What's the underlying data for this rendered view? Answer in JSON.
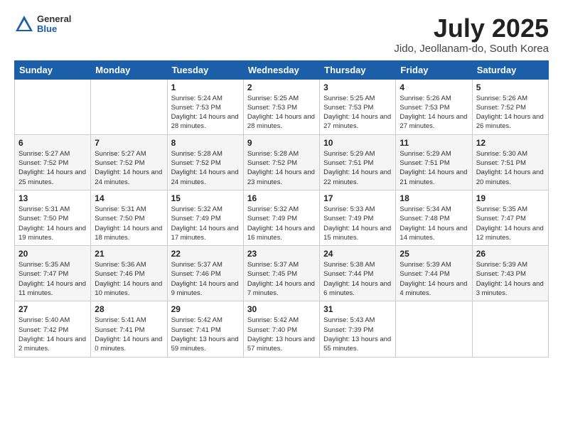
{
  "header": {
    "logo_general": "General",
    "logo_blue": "Blue",
    "month_title": "July 2025",
    "location": "Jido, Jeollanam-do, South Korea"
  },
  "days_of_week": [
    "Sunday",
    "Monday",
    "Tuesday",
    "Wednesday",
    "Thursday",
    "Friday",
    "Saturday"
  ],
  "weeks": [
    [
      {
        "day": "",
        "info": ""
      },
      {
        "day": "",
        "info": ""
      },
      {
        "day": "1",
        "info": "Sunrise: 5:24 AM\nSunset: 7:53 PM\nDaylight: 14 hours\nand 28 minutes."
      },
      {
        "day": "2",
        "info": "Sunrise: 5:25 AM\nSunset: 7:53 PM\nDaylight: 14 hours\nand 28 minutes."
      },
      {
        "day": "3",
        "info": "Sunrise: 5:25 AM\nSunset: 7:53 PM\nDaylight: 14 hours\nand 27 minutes."
      },
      {
        "day": "4",
        "info": "Sunrise: 5:26 AM\nSunset: 7:53 PM\nDaylight: 14 hours\nand 27 minutes."
      },
      {
        "day": "5",
        "info": "Sunrise: 5:26 AM\nSunset: 7:52 PM\nDaylight: 14 hours\nand 26 minutes."
      }
    ],
    [
      {
        "day": "6",
        "info": "Sunrise: 5:27 AM\nSunset: 7:52 PM\nDaylight: 14 hours\nand 25 minutes."
      },
      {
        "day": "7",
        "info": "Sunrise: 5:27 AM\nSunset: 7:52 PM\nDaylight: 14 hours\nand 24 minutes."
      },
      {
        "day": "8",
        "info": "Sunrise: 5:28 AM\nSunset: 7:52 PM\nDaylight: 14 hours\nand 24 minutes."
      },
      {
        "day": "9",
        "info": "Sunrise: 5:28 AM\nSunset: 7:52 PM\nDaylight: 14 hours\nand 23 minutes."
      },
      {
        "day": "10",
        "info": "Sunrise: 5:29 AM\nSunset: 7:51 PM\nDaylight: 14 hours\nand 22 minutes."
      },
      {
        "day": "11",
        "info": "Sunrise: 5:29 AM\nSunset: 7:51 PM\nDaylight: 14 hours\nand 21 minutes."
      },
      {
        "day": "12",
        "info": "Sunrise: 5:30 AM\nSunset: 7:51 PM\nDaylight: 14 hours\nand 20 minutes."
      }
    ],
    [
      {
        "day": "13",
        "info": "Sunrise: 5:31 AM\nSunset: 7:50 PM\nDaylight: 14 hours\nand 19 minutes."
      },
      {
        "day": "14",
        "info": "Sunrise: 5:31 AM\nSunset: 7:50 PM\nDaylight: 14 hours\nand 18 minutes."
      },
      {
        "day": "15",
        "info": "Sunrise: 5:32 AM\nSunset: 7:49 PM\nDaylight: 14 hours\nand 17 minutes."
      },
      {
        "day": "16",
        "info": "Sunrise: 5:32 AM\nSunset: 7:49 PM\nDaylight: 14 hours\nand 16 minutes."
      },
      {
        "day": "17",
        "info": "Sunrise: 5:33 AM\nSunset: 7:49 PM\nDaylight: 14 hours\nand 15 minutes."
      },
      {
        "day": "18",
        "info": "Sunrise: 5:34 AM\nSunset: 7:48 PM\nDaylight: 14 hours\nand 14 minutes."
      },
      {
        "day": "19",
        "info": "Sunrise: 5:35 AM\nSunset: 7:47 PM\nDaylight: 14 hours\nand 12 minutes."
      }
    ],
    [
      {
        "day": "20",
        "info": "Sunrise: 5:35 AM\nSunset: 7:47 PM\nDaylight: 14 hours\nand 11 minutes."
      },
      {
        "day": "21",
        "info": "Sunrise: 5:36 AM\nSunset: 7:46 PM\nDaylight: 14 hours\nand 10 minutes."
      },
      {
        "day": "22",
        "info": "Sunrise: 5:37 AM\nSunset: 7:46 PM\nDaylight: 14 hours\nand 9 minutes."
      },
      {
        "day": "23",
        "info": "Sunrise: 5:37 AM\nSunset: 7:45 PM\nDaylight: 14 hours\nand 7 minutes."
      },
      {
        "day": "24",
        "info": "Sunrise: 5:38 AM\nSunset: 7:44 PM\nDaylight: 14 hours\nand 6 minutes."
      },
      {
        "day": "25",
        "info": "Sunrise: 5:39 AM\nSunset: 7:44 PM\nDaylight: 14 hours\nand 4 minutes."
      },
      {
        "day": "26",
        "info": "Sunrise: 5:39 AM\nSunset: 7:43 PM\nDaylight: 14 hours\nand 3 minutes."
      }
    ],
    [
      {
        "day": "27",
        "info": "Sunrise: 5:40 AM\nSunset: 7:42 PM\nDaylight: 14 hours\nand 2 minutes."
      },
      {
        "day": "28",
        "info": "Sunrise: 5:41 AM\nSunset: 7:41 PM\nDaylight: 14 hours\nand 0 minutes."
      },
      {
        "day": "29",
        "info": "Sunrise: 5:42 AM\nSunset: 7:41 PM\nDaylight: 13 hours\nand 59 minutes."
      },
      {
        "day": "30",
        "info": "Sunrise: 5:42 AM\nSunset: 7:40 PM\nDaylight: 13 hours\nand 57 minutes."
      },
      {
        "day": "31",
        "info": "Sunrise: 5:43 AM\nSunset: 7:39 PM\nDaylight: 13 hours\nand 55 minutes."
      },
      {
        "day": "",
        "info": ""
      },
      {
        "day": "",
        "info": ""
      }
    ]
  ]
}
